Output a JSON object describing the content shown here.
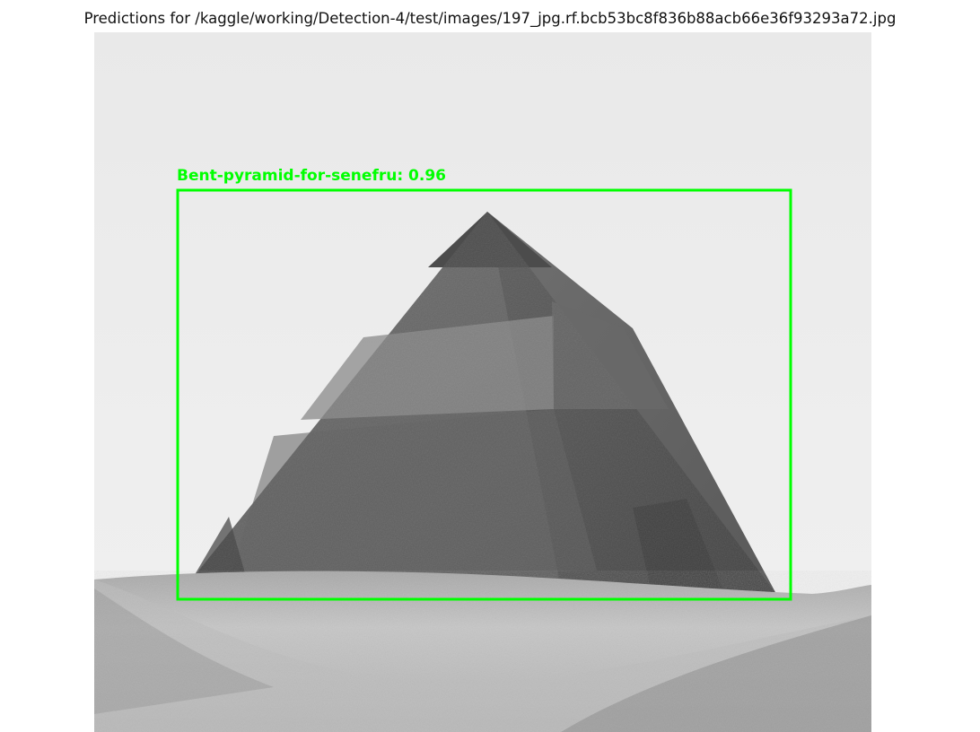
{
  "figure": {
    "title": "Predictions for /kaggle/working/Detection-4/test/images/197_jpg.rf.bcb53bc8f836b88acb66e36f93293a72.jpg"
  },
  "photo": {
    "subject": "pyramid",
    "detections": [
      {
        "label": "Bent-pyramid-for-senefru: 0.96",
        "class_name": "Bent-pyramid-for-senefru",
        "confidence": 0.96,
        "color": "#00ff00"
      }
    ]
  }
}
